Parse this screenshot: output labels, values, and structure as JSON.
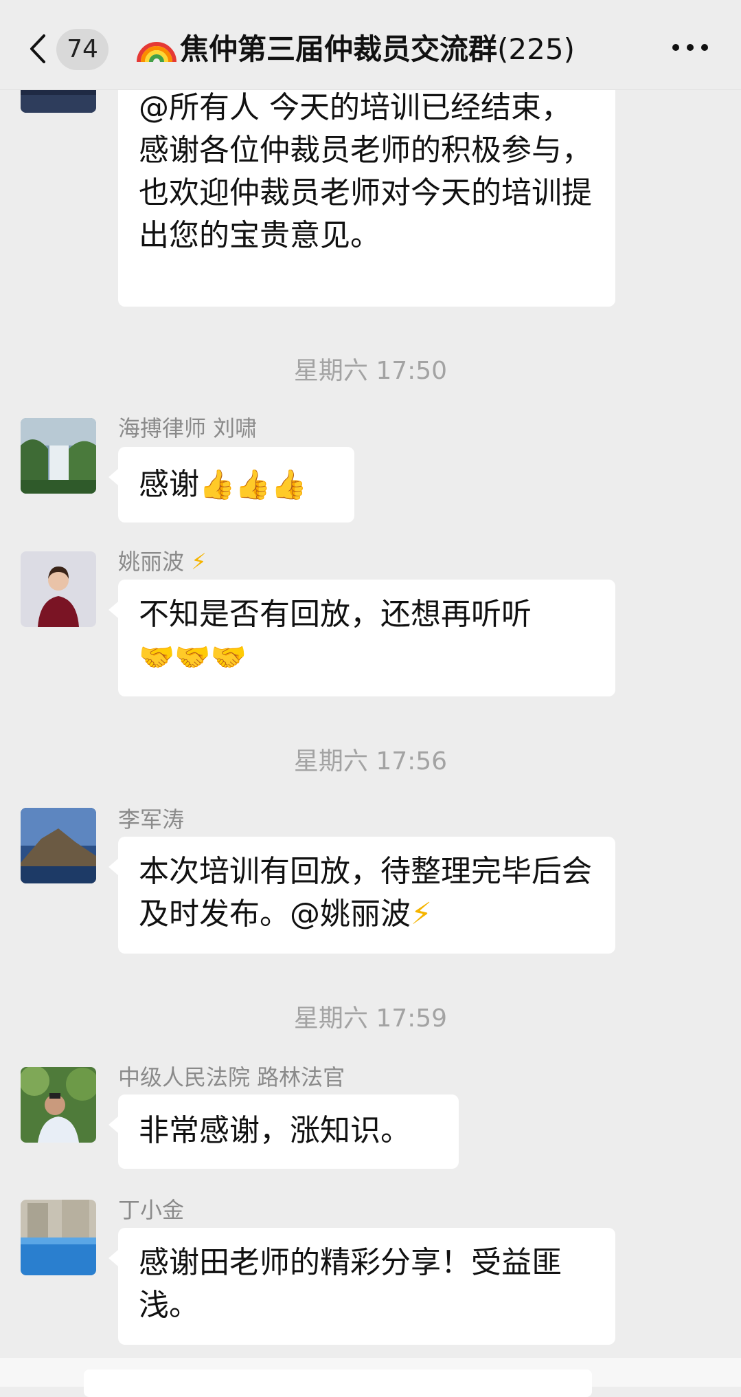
{
  "header": {
    "unread_count": "74",
    "title": "焦仲第三届仲裁员交流群",
    "member_count": "(225)"
  },
  "messages": [
    {
      "text": "@所有人 今天的培训已经结束，感谢各位仲裁员老师的积极参与，也欢迎仲裁员老师对今天的培训提出您的宝贵意见。"
    },
    {
      "timestamp": "星期六 17:50",
      "sender": "海搏律师 刘啸",
      "text": "感谢",
      "emoji": "👍👍👍"
    },
    {
      "sender": "姚丽波",
      "sender_suffix": "⚡",
      "text": "不知是否有回放，还想再听听",
      "emoji": "🤝🤝🤝"
    },
    {
      "timestamp": "星期六 17:56",
      "sender": "李军涛",
      "text": "本次培训有回放，待整理完毕后会及时发布。@姚丽波",
      "text_suffix": "⚡"
    },
    {
      "timestamp": "星期六 17:59",
      "sender": "中级人民法院 路林法官",
      "text": "非常感谢，涨知识。"
    },
    {
      "sender": "丁小金",
      "text": "感谢田老师的精彩分享！受益匪浅。"
    }
  ]
}
